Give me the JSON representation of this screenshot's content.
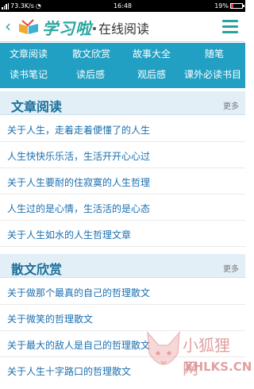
{
  "status": {
    "carrier": "73.3K/s",
    "time": "16:48",
    "battery": "19%",
    "battery_level": 0.19
  },
  "header": {
    "brand": "学习啦",
    "subtitle": "在线阅读"
  },
  "nav": [
    "文章阅读",
    "散文欣赏",
    "故事大全",
    "随笔",
    "读书笔记",
    "读后感",
    "观后感",
    "课外必读书目"
  ],
  "sections": [
    {
      "title": "文章阅读",
      "more": "更多",
      "items": [
        "关于人生，走着走着便懂了的人生",
        "人生快快乐乐活，生活开开心心过",
        "关于人生要耐的住寂寞的人生哲理",
        "人生过的是心情，生活活的是心态",
        "关于人生如水的人生哲理文章"
      ]
    },
    {
      "title": "散文欣赏",
      "more": "更多",
      "items": [
        "关于做那个最真的自己的哲理散文",
        "关于微笑的哲理散文",
        "关于最大的敌人是自己的哲理散文",
        "关于人生十字路口的哲理散文"
      ]
    }
  ],
  "watermark": {
    "cn": "小狐狸网",
    "en": "XHLKS.CN"
  },
  "colors": {
    "accent": "#27a6a0",
    "nav_bg": "#21a0c3",
    "section_bg": "#e2eff7",
    "link": "#1a6fb0"
  }
}
